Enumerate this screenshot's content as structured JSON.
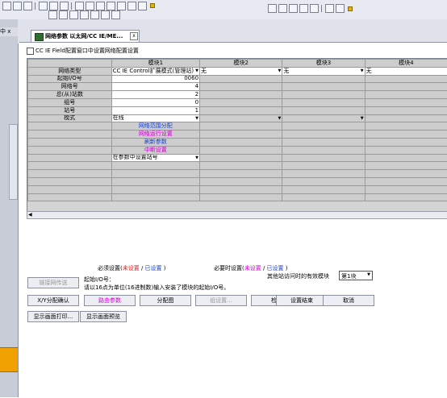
{
  "tab": {
    "label": "网络参数 以太网/CC IE/ME...",
    "close": "x"
  },
  "left_dock": {
    "pin": "中 x"
  },
  "checkbox_label": "CC IE Field配置窗口中设置网络配置设置",
  "grid": {
    "columns": [
      "模块1",
      "模块2",
      "模块3",
      "模块4"
    ],
    "rows": {
      "network_type": {
        "label": "网络类型",
        "m1": "CC IE Control扩展模式(管理站)",
        "m2": "无",
        "m3": "无",
        "m4": "无"
      },
      "start_io": {
        "label": "起始I/O号",
        "m1": "0060"
      },
      "network_no": {
        "label": "网络号",
        "m1": "4"
      },
      "total_stations": {
        "label": "总(从)站数",
        "m1": "2"
      },
      "group_no": {
        "label": "组号",
        "m1": "0"
      },
      "station_no": {
        "label": "站号",
        "m1": "1"
      },
      "mode": {
        "label": "模式",
        "m1": "在线"
      }
    },
    "links": {
      "range_assign": "网络范围分配",
      "refresh_parameter": "刷新参数",
      "interrupt_setting": "中断设置",
      "network_operation": "网络运行设置",
      "station_no_setting": "在参数中设置站号"
    }
  },
  "legend": {
    "required_label": "必须设置(",
    "optional_label": "必要时设置(",
    "not_set": "未设置",
    "slash": " / ",
    "set": "已设置",
    "close_paren": " )"
  },
  "routing_button": "链接网传送",
  "start_io_info": {
    "label": "起始I/O号：",
    "hint": "请以16点为单位(16进制数)输入安装了模块的起始I/O号。"
  },
  "valid_module": {
    "label": "其他站访问时的有效模块",
    "value": "第1块"
  },
  "buttons_row1": {
    "xy_confirm": "X/Y分配确认",
    "routing_param": "路由参数",
    "assign_diagram": "分配图",
    "group_setting": "组设置...",
    "check": "检查",
    "setting_end": "设置结束",
    "cancel": "取消"
  },
  "buttons_row2": {
    "print_screen": "显示画面打印...",
    "preview_screen": "显示画面预览"
  },
  "colors": {
    "required_red": "#e02020",
    "set_blue": "#1a3fd0",
    "optional_magenta": "#d000d0",
    "accent_orange": "#f0a000"
  }
}
